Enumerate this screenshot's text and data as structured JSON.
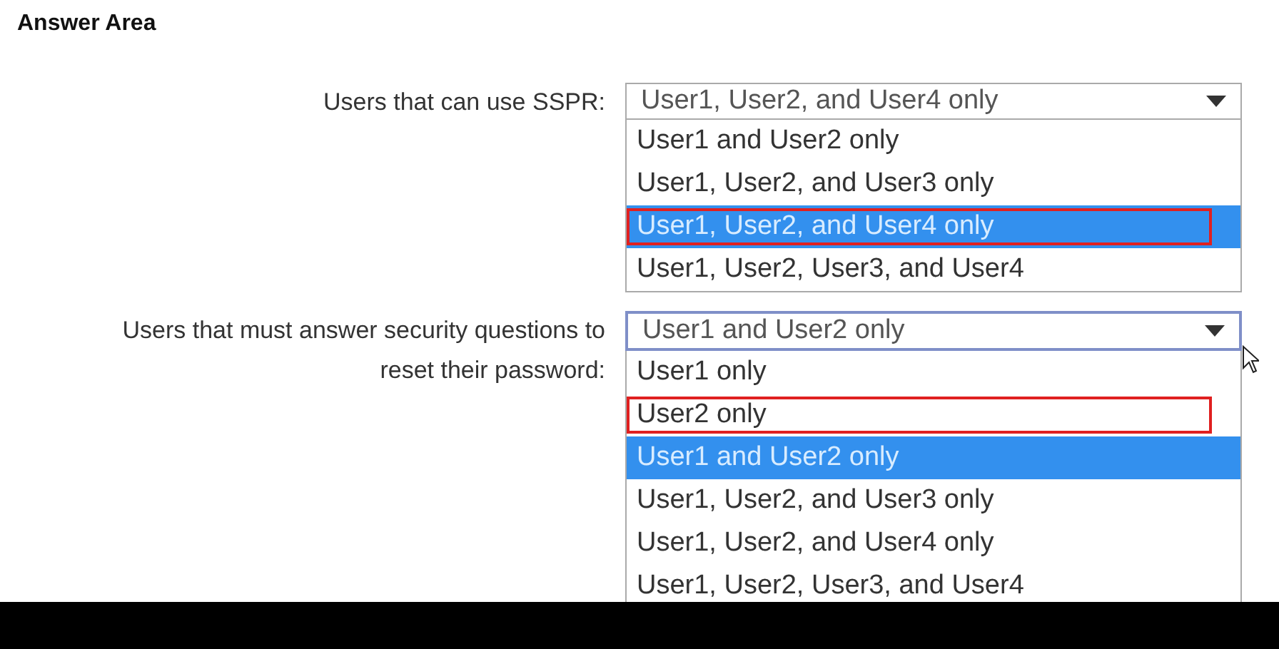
{
  "title": "Answer Area",
  "questions": [
    {
      "label": "Users that can use SSPR:",
      "value": "User1, User2, and User4 only",
      "focused": false,
      "options": [
        {
          "text": "User1 and User2 only",
          "selected": false,
          "marked": false
        },
        {
          "text": "User1, User2, and User3 only",
          "selected": false,
          "marked": false
        },
        {
          "text": "User1, User2, and User4 only",
          "selected": true,
          "marked": true
        },
        {
          "text": "User1, User2, User3, and User4",
          "selected": false,
          "marked": false
        }
      ]
    },
    {
      "label": "Users that must answer security questions to reset their password:",
      "value": "User1 and User2 only",
      "focused": true,
      "options": [
        {
          "text": "User1 only",
          "selected": false,
          "marked": false
        },
        {
          "text": "User2 only",
          "selected": false,
          "marked": true
        },
        {
          "text": "User1 and User2 only",
          "selected": true,
          "marked": false
        },
        {
          "text": "User1, User2, and User3 only",
          "selected": false,
          "marked": false
        },
        {
          "text": "User1, User2, and User4 only",
          "selected": false,
          "marked": false
        },
        {
          "text": "User1, User2, User3, and User4",
          "selected": false,
          "marked": false
        }
      ]
    }
  ]
}
